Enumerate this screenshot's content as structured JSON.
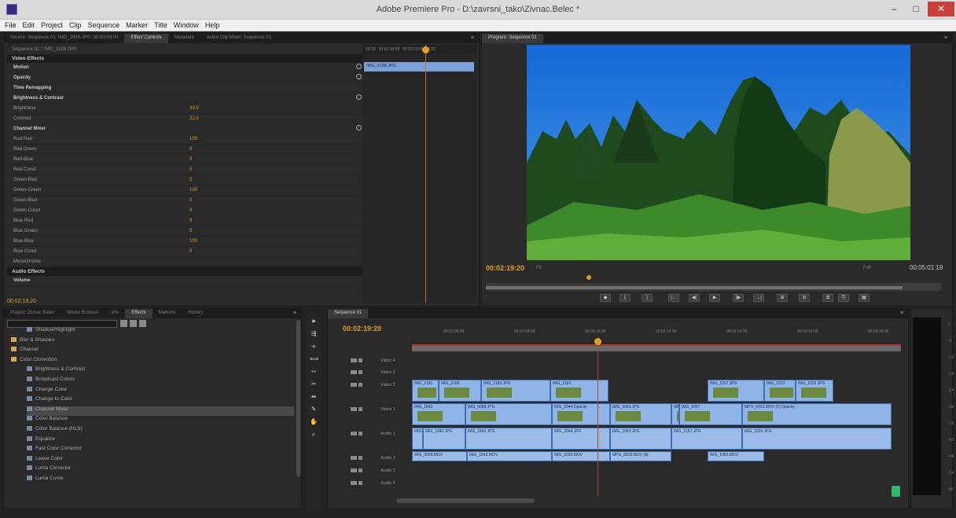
{
  "window": {
    "title": "Adobe Premiere Pro - D:\\zavrsni_tako\\Zivnac.Belec *",
    "min_label": "–",
    "max_label": "□",
    "close_label": "✕"
  },
  "menu": [
    "File",
    "Edit",
    "Project",
    "Clip",
    "Sequence",
    "Marker",
    "Title",
    "Window",
    "Help"
  ],
  "source_panel": {
    "tabs": [
      "Source: Sequence 01: IMG_2065.JPG: 00:00:00:00",
      "Effect Controls",
      "Metadata",
      "Audio Clip Mixer: Sequence 01"
    ],
    "active_tab": 1
  },
  "effect_controls": {
    "sequence_label": "Sequence 01 * IMG_2188.JPG",
    "video_effects_label": "Video Effects",
    "audio_effects_label": "Audio Effects",
    "rows": [
      {
        "name": "Motion",
        "value": "",
        "fx": true,
        "reset": true
      },
      {
        "name": "Opacity",
        "value": "",
        "fx": true,
        "reset": true
      },
      {
        "name": "Time Remapping",
        "value": "",
        "fx": true,
        "reset": false
      },
      {
        "name": "Brightness & Contrast",
        "value": "",
        "fx": true,
        "reset": true
      },
      {
        "name": "Brightness",
        "value": "39.0",
        "fx": false,
        "reset": false
      },
      {
        "name": "Contrast",
        "value": "22.0",
        "fx": false,
        "reset": false
      },
      {
        "name": "Channel Mixer",
        "value": "",
        "fx": true,
        "reset": true
      },
      {
        "name": "Red-Red",
        "value": "100",
        "fx": false,
        "reset": false
      },
      {
        "name": "Red-Green",
        "value": "0",
        "fx": false,
        "reset": false
      },
      {
        "name": "Red-Blue",
        "value": "0",
        "fx": false,
        "reset": false
      },
      {
        "name": "Red-Const",
        "value": "0",
        "fx": false,
        "reset": false
      },
      {
        "name": "Green-Red",
        "value": "0",
        "fx": false,
        "reset": false
      },
      {
        "name": "Green-Green",
        "value": "100",
        "fx": false,
        "reset": false
      },
      {
        "name": "Green-Blue",
        "value": "0",
        "fx": false,
        "reset": false
      },
      {
        "name": "Green-Const",
        "value": "0",
        "fx": false,
        "reset": false
      },
      {
        "name": "Blue-Red",
        "value": "0",
        "fx": false,
        "reset": false
      },
      {
        "name": "Blue-Green",
        "value": "0",
        "fx": false,
        "reset": false
      },
      {
        "name": "Blue-Blue",
        "value": "100",
        "fx": false,
        "reset": false
      },
      {
        "name": "Blue-Const",
        "value": "0",
        "fx": false,
        "reset": false
      },
      {
        "name": "Monochrome",
        "value": "",
        "fx": false,
        "reset": false
      }
    ],
    "volume_label": "Volume",
    "timecode": "00:02:19:20",
    "clip_label": "IMG_2188.JPG",
    "ruler_labels": [
      "00:00",
      "00:02:18:08",
      "00:02:20:00",
      "00:02"
    ]
  },
  "program": {
    "tab_label": "Program: Sequence 01",
    "timecode": "00:02:19:20",
    "fit_label": "Fit",
    "full_label": "Full",
    "duration": "00:05:01:19",
    "transport": [
      "◆",
      "{",
      "}",
      "|←",
      "◀|",
      "▶",
      "|▶",
      "→|",
      "⊞",
      "⊟",
      "⧉",
      "⎘",
      "▦"
    ]
  },
  "project_panel": {
    "tabs": [
      "Project: Zivnac Belec",
      "Media Browser",
      "Info",
      "Effects",
      "Markers",
      "History"
    ],
    "active_tab": 3,
    "items": [
      {
        "label": "Shadow/Highlight",
        "folder": false
      },
      {
        "label": "Blur & Sharpen",
        "folder": true
      },
      {
        "label": "Channel",
        "folder": true
      },
      {
        "label": "Color Correction",
        "folder": true
      },
      {
        "label": "Brightness & Contrast",
        "folder": false
      },
      {
        "label": "Broadcast Colors",
        "folder": false
      },
      {
        "label": "Change Color",
        "folder": false
      },
      {
        "label": "Change to Color",
        "folder": false
      },
      {
        "label": "Channel Mixer",
        "folder": false
      },
      {
        "label": "Color Balance",
        "folder": false
      },
      {
        "label": "Color Balance (HLS)",
        "folder": false
      },
      {
        "label": "Equalize",
        "folder": false
      },
      {
        "label": "Fast Color Corrector",
        "folder": false
      },
      {
        "label": "Leave Color",
        "folder": false
      },
      {
        "label": "Luma Corrector",
        "folder": false
      },
      {
        "label": "Luma Curve",
        "folder": false
      }
    ],
    "selected_index": 8
  },
  "sequence": {
    "tab_label": "Sequence 01",
    "timecode": "00:02:19:20",
    "ruler": [
      "00:02:06:00",
      "00:02:08:00",
      "00:02:10:00",
      "00:02:12:00",
      "00:02:14:00",
      "00:02:16:00",
      "00:02:18:00",
      "00:02:20:00"
    ],
    "tracks": [
      {
        "id": "V4",
        "label": "Video 4"
      },
      {
        "id": "V3",
        "label": "Video 3"
      },
      {
        "id": "V2",
        "label": "Video 2"
      },
      {
        "id": "V1",
        "label": "Video 1"
      },
      {
        "id": "A1",
        "label": "Audio 1"
      },
      {
        "id": "A2",
        "label": "Audio 2"
      },
      {
        "id": "A3",
        "label": "Audio 3"
      },
      {
        "id": "A4",
        "label": "Audio 4"
      }
    ],
    "v2_clips": [
      "IMG_2181",
      "IMG_2188",
      "IMG_2189.JPG",
      "IMG_2193",
      "IMG_2207.JPG",
      "IMG_2220",
      "IMG_2226.JPG"
    ],
    "v1_clips": [
      "IMG_1842",
      "IMG_0088.JPG",
      "IMG_2044 Opacity",
      "IMG_2093.JPG",
      "MPO_0019.MOV [V]",
      "IMG_2097",
      "MPO_0019.MOV [V] Opacity"
    ],
    "a1_clips": [
      "IMG_0008.MOV",
      "IMG_1842.MOV",
      "IMG_2093.MOV",
      "MPO_0019.MOV [A]",
      "IMG_1955.MOV"
    ],
    "a2_clips": [
      "IMG_1820",
      "IMG_1842.JPG",
      "IMG_1856.JPG",
      "IMG_2044.JPG",
      "IMG_2093.JPG",
      "IMG_2197.JPG",
      "IMG_2226.JPG"
    ]
  },
  "meter_scale": [
    "0",
    "-6",
    "-12",
    "-18",
    "-24",
    "-30",
    "-36",
    "-42",
    "-48",
    "-54",
    "dB"
  ]
}
